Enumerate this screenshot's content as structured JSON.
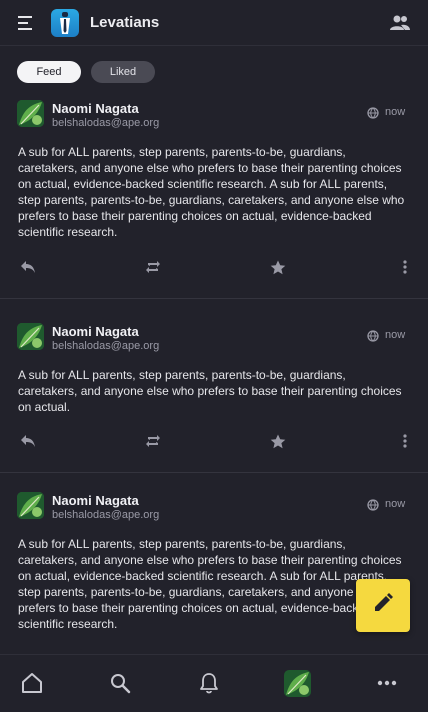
{
  "app": {
    "title": "Levatians"
  },
  "tabs": [
    {
      "label": "Feed",
      "active": true
    },
    {
      "label": "Liked",
      "active": false
    }
  ],
  "posts": [
    {
      "author": "Naomi Nagata",
      "handle": "belshalodas@ape.org",
      "time": "now",
      "content": "A sub for ALL parents, step parents, parents-to-be, guardians, caretakers, and anyone else who prefers to base their parenting choices on actual, evidence-backed scientific research. A sub for ALL parents, step parents, parents-to-be, guardians, caretakers, and anyone else who prefers to base their parenting choices on actual, evidence-backed scientific research."
    },
    {
      "author": "Naomi Nagata",
      "handle": "belshalodas@ape.org",
      "time": "now",
      "content": "A sub for ALL parents, step parents, parents-to-be, guardians, caretakers, and anyone else who prefers to base their parenting choices on actual."
    },
    {
      "author": "Naomi Nagata",
      "handle": "belshalodas@ape.org",
      "time": "now",
      "content": "A sub for ALL parents, step parents, parents-to-be, guardians, caretakers, and anyone else who prefers to base their parenting choices on actual, evidence-backed scientific research. A sub for ALL parents, step parents, parents-to-be, guardians, caretakers, and anyone else who prefers to base their parenting choices on actual, evidence-backed scientific research."
    }
  ],
  "icons": {
    "menu": "menu-icon",
    "people": "people-icon",
    "globe": "globe-icon",
    "reply": "reply-icon",
    "boost": "repeat-icon",
    "favorite": "star-icon",
    "more": "more-vertical-icon",
    "compose": "pencil-icon",
    "home": "home-icon",
    "search": "search-icon",
    "notifications": "bell-icon",
    "more_horizontal": "more-horizontal-icon"
  },
  "colors": {
    "background": "#22222b",
    "accent": "#f5d93f",
    "muted": "#9a9aa6"
  }
}
